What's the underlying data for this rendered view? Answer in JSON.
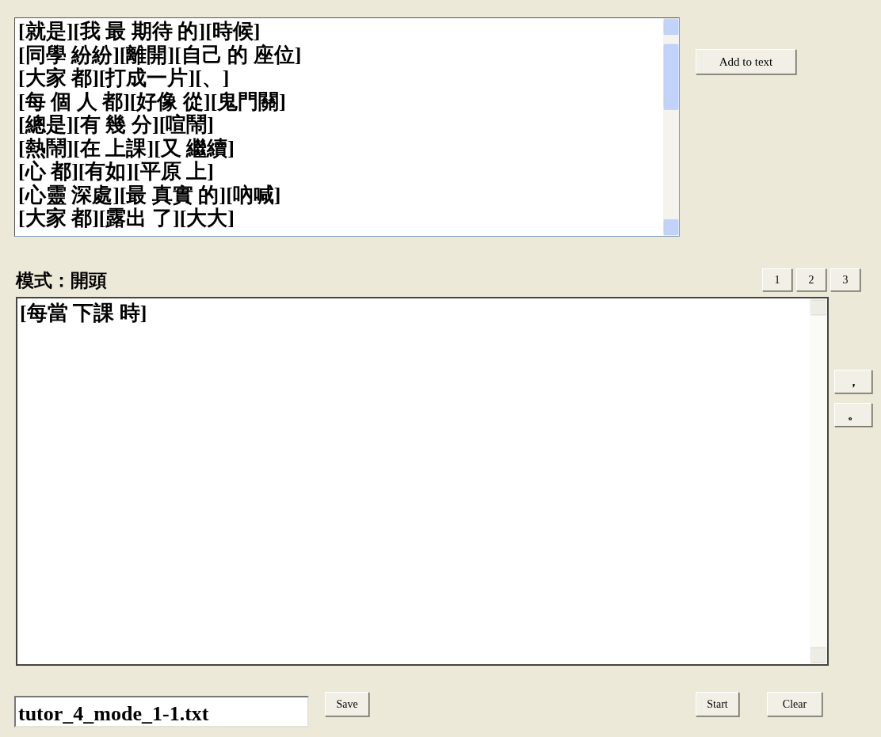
{
  "phrase_list": {
    "items": [
      "[就是][我 最 期待 的][時候]",
      "[同學 紛紛][離開][自己 的 座位]",
      "[大家 都][打成一片][、]",
      "[每 個 人 都][好像 從][鬼門關]",
      "[總是][有 幾 分][喧鬧]",
      "[熱鬧][在 上課][又 繼續]",
      "[心 都][有如][平原 上]",
      "[心靈 深處][最 真實 的][吶喊]",
      "[大家 都][露出 了][大大]"
    ]
  },
  "add_button": "Add to text",
  "mode_label": "模式：開頭",
  "mode_buttons": [
    "1",
    "2",
    "3"
  ],
  "editor": {
    "value": "[每當 下課 時]"
  },
  "punctuation_buttons": [
    "，",
    "。"
  ],
  "filename": {
    "value": "tutor_4_mode_1-1.txt"
  },
  "save_button": "Save",
  "start_button": "Start",
  "clear_button": "Clear"
}
